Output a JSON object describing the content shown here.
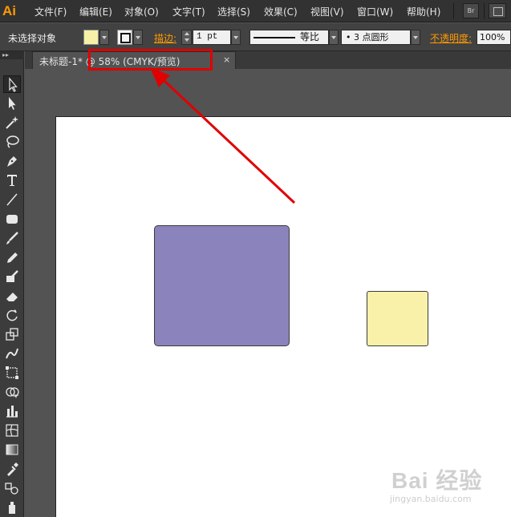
{
  "app": {
    "logo": "Ai",
    "menu": [
      "文件(F)",
      "编辑(E)",
      "对象(O)",
      "文字(T)",
      "选择(S)",
      "效果(C)",
      "视图(V)",
      "窗口(W)",
      "帮助(H)"
    ],
    "bridge_button": "Br"
  },
  "control_bar": {
    "selection_status": "未选择对象",
    "stroke_label": "描边:",
    "stroke_weight": "1 pt",
    "profile_label": "等比",
    "brush_label": "• 3 点圆形",
    "opacity_label": "不透明度:",
    "opacity_value": "100%",
    "fill_color": "#f7f0a7"
  },
  "document": {
    "tab_title": "未标题-1* @ 58% (CMYK/预览)",
    "close_glyph": "×"
  },
  "artboard": {
    "shapes": [
      {
        "name": "purple-rectangle",
        "color": "#8b83bb"
      },
      {
        "name": "yellow-rectangle",
        "color": "#f9f1a9"
      }
    ]
  },
  "annotation": {
    "color": "#e00000"
  },
  "toolbox": {
    "tools": [
      "selection-tool",
      "direct-selection-tool",
      "magic-wand-tool",
      "lasso-tool",
      "pen-tool",
      "type-tool",
      "line-tool",
      "rectangle-tool",
      "paintbrush-tool",
      "pencil-tool",
      "blob-brush-tool",
      "eraser-tool",
      "rotate-tool",
      "scale-tool",
      "warp-tool",
      "free-transform-tool",
      "shape-builder-tool",
      "graph-tool",
      "mesh-tool",
      "gradient-tool",
      "eyedropper-tool",
      "blend-tool",
      "symbol-sprayer-tool"
    ]
  },
  "watermark": {
    "main": "Bai 经验",
    "sub": "jingyan.baidu.com"
  }
}
